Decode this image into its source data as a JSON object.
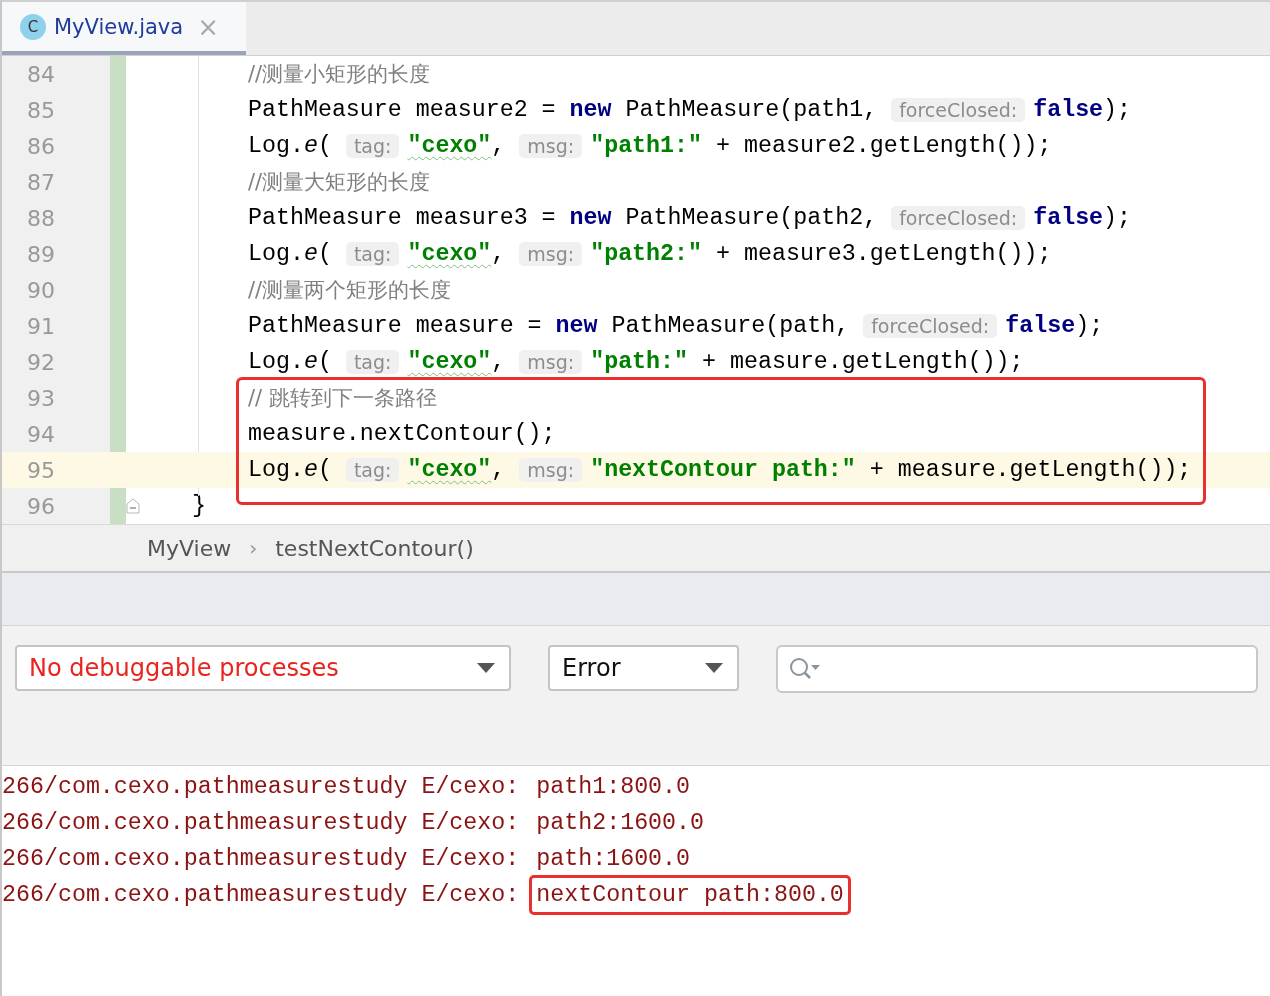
{
  "tab": {
    "title": "MyView.java",
    "icon_letter": "C",
    "close": "×"
  },
  "lines": [
    {
      "number": "84",
      "kind": "body",
      "current": false,
      "boxed": false,
      "tokens": [
        {
          "kind": "comment",
          "text": "//测量小矩形的长度"
        }
      ]
    },
    {
      "number": "85",
      "kind": "body",
      "current": false,
      "boxed": false,
      "tokens": [
        {
          "kind": "plain",
          "text": "PathMeasure measure2 = "
        },
        {
          "kind": "keyword",
          "text": "new"
        },
        {
          "kind": "plain",
          "text": " PathMeasure(path1, "
        },
        {
          "kind": "hint",
          "text": "forceClosed:"
        },
        {
          "kind": "keyword",
          "text": "false"
        },
        {
          "kind": "plain",
          "text": ");"
        }
      ]
    },
    {
      "number": "86",
      "kind": "body",
      "current": false,
      "boxed": false,
      "tokens": [
        {
          "kind": "plain",
          "text": "Log."
        },
        {
          "kind": "static",
          "text": "e"
        },
        {
          "kind": "plain",
          "text": "( "
        },
        {
          "kind": "hint",
          "text": "tag:"
        },
        {
          "kind": "typo-string",
          "text": "\"cexo\""
        },
        {
          "kind": "plain",
          "text": ", "
        },
        {
          "kind": "hint",
          "text": "msg:"
        },
        {
          "kind": "string",
          "text": "\"path1:\""
        },
        {
          "kind": "plain",
          "text": " + measure2.getLength());"
        }
      ]
    },
    {
      "number": "87",
      "kind": "body",
      "current": false,
      "boxed": false,
      "tokens": [
        {
          "kind": "comment",
          "text": "//测量大矩形的长度"
        }
      ]
    },
    {
      "number": "88",
      "kind": "body",
      "current": false,
      "boxed": false,
      "tokens": [
        {
          "kind": "plain",
          "text": "PathMeasure measure3 = "
        },
        {
          "kind": "keyword",
          "text": "new"
        },
        {
          "kind": "plain",
          "text": " PathMeasure(path2, "
        },
        {
          "kind": "hint",
          "text": "forceClosed:"
        },
        {
          "kind": "keyword",
          "text": "false"
        },
        {
          "kind": "plain",
          "text": ");"
        }
      ]
    },
    {
      "number": "89",
      "kind": "body",
      "current": false,
      "boxed": false,
      "tokens": [
        {
          "kind": "plain",
          "text": "Log."
        },
        {
          "kind": "static",
          "text": "e"
        },
        {
          "kind": "plain",
          "text": "( "
        },
        {
          "kind": "hint",
          "text": "tag:"
        },
        {
          "kind": "typo-string",
          "text": "\"cexo\""
        },
        {
          "kind": "plain",
          "text": ", "
        },
        {
          "kind": "hint",
          "text": "msg:"
        },
        {
          "kind": "string",
          "text": "\"path2:\""
        },
        {
          "kind": "plain",
          "text": " + measure3.getLength());"
        }
      ]
    },
    {
      "number": "90",
      "kind": "body",
      "current": false,
      "boxed": false,
      "tokens": [
        {
          "kind": "comment",
          "text": "//测量两个矩形的长度"
        }
      ]
    },
    {
      "number": "91",
      "kind": "body",
      "current": false,
      "boxed": false,
      "tokens": [
        {
          "kind": "plain",
          "text": "PathMeasure measure = "
        },
        {
          "kind": "keyword",
          "text": "new"
        },
        {
          "kind": "plain",
          "text": " PathMeasure(path, "
        },
        {
          "kind": "hint",
          "text": "forceClosed:"
        },
        {
          "kind": "keyword",
          "text": "false"
        },
        {
          "kind": "plain",
          "text": ");"
        }
      ]
    },
    {
      "number": "92",
      "kind": "body",
      "current": false,
      "boxed": false,
      "tokens": [
        {
          "kind": "plain",
          "text": "Log."
        },
        {
          "kind": "static",
          "text": "e"
        },
        {
          "kind": "plain",
          "text": "( "
        },
        {
          "kind": "hint",
          "text": "tag:"
        },
        {
          "kind": "typo-string",
          "text": "\"cexo\""
        },
        {
          "kind": "plain",
          "text": ", "
        },
        {
          "kind": "hint",
          "text": "msg:"
        },
        {
          "kind": "string",
          "text": "\"path:\""
        },
        {
          "kind": "plain",
          "text": " + measure.getLength());"
        }
      ]
    },
    {
      "number": "93",
      "kind": "body",
      "current": false,
      "boxed": true,
      "tokens": [
        {
          "kind": "comment",
          "text": "// 跳转到下一条路径"
        }
      ]
    },
    {
      "number": "94",
      "kind": "body",
      "current": false,
      "boxed": true,
      "tokens": [
        {
          "kind": "plain",
          "text": "measure.nextContour();"
        }
      ]
    },
    {
      "number": "95",
      "kind": "body",
      "current": true,
      "boxed": true,
      "tokens": [
        {
          "kind": "plain",
          "text": "Log."
        },
        {
          "kind": "static",
          "text": "e"
        },
        {
          "kind": "plain",
          "text": "( "
        },
        {
          "kind": "hint",
          "text": "tag:"
        },
        {
          "kind": "typo-string",
          "text": "\"cexo\""
        },
        {
          "kind": "plain",
          "text": ", "
        },
        {
          "kind": "hint",
          "text": "msg:"
        },
        {
          "kind": "string",
          "text": "\"nextContour path:\""
        },
        {
          "kind": "plain",
          "text": " + measure.getLength());"
        }
      ]
    },
    {
      "number": "96",
      "kind": "close",
      "current": false,
      "boxed": false,
      "tokens": [
        {
          "kind": "plain",
          "text": "}"
        }
      ]
    }
  ],
  "breadcrumb": [
    "MyView",
    "testNextContour()"
  ],
  "breadcrumb_separator": "›",
  "logcat": {
    "process": "No debuggable processes",
    "level": "Error",
    "entries": [
      {
        "tag": "266/com.cexo.pathmeasurestudy E/cexo:",
        "message": "path1:800.0",
        "boxed": false
      },
      {
        "tag": "266/com.cexo.pathmeasurestudy E/cexo:",
        "message": "path2:1600.0",
        "boxed": false
      },
      {
        "tag": "266/com.cexo.pathmeasurestudy E/cexo:",
        "message": "path:1600.0",
        "boxed": false
      },
      {
        "tag": "266/com.cexo.pathmeasurestudy E/cexo:",
        "message": "nextContour path:800.0",
        "boxed": true
      }
    ]
  }
}
